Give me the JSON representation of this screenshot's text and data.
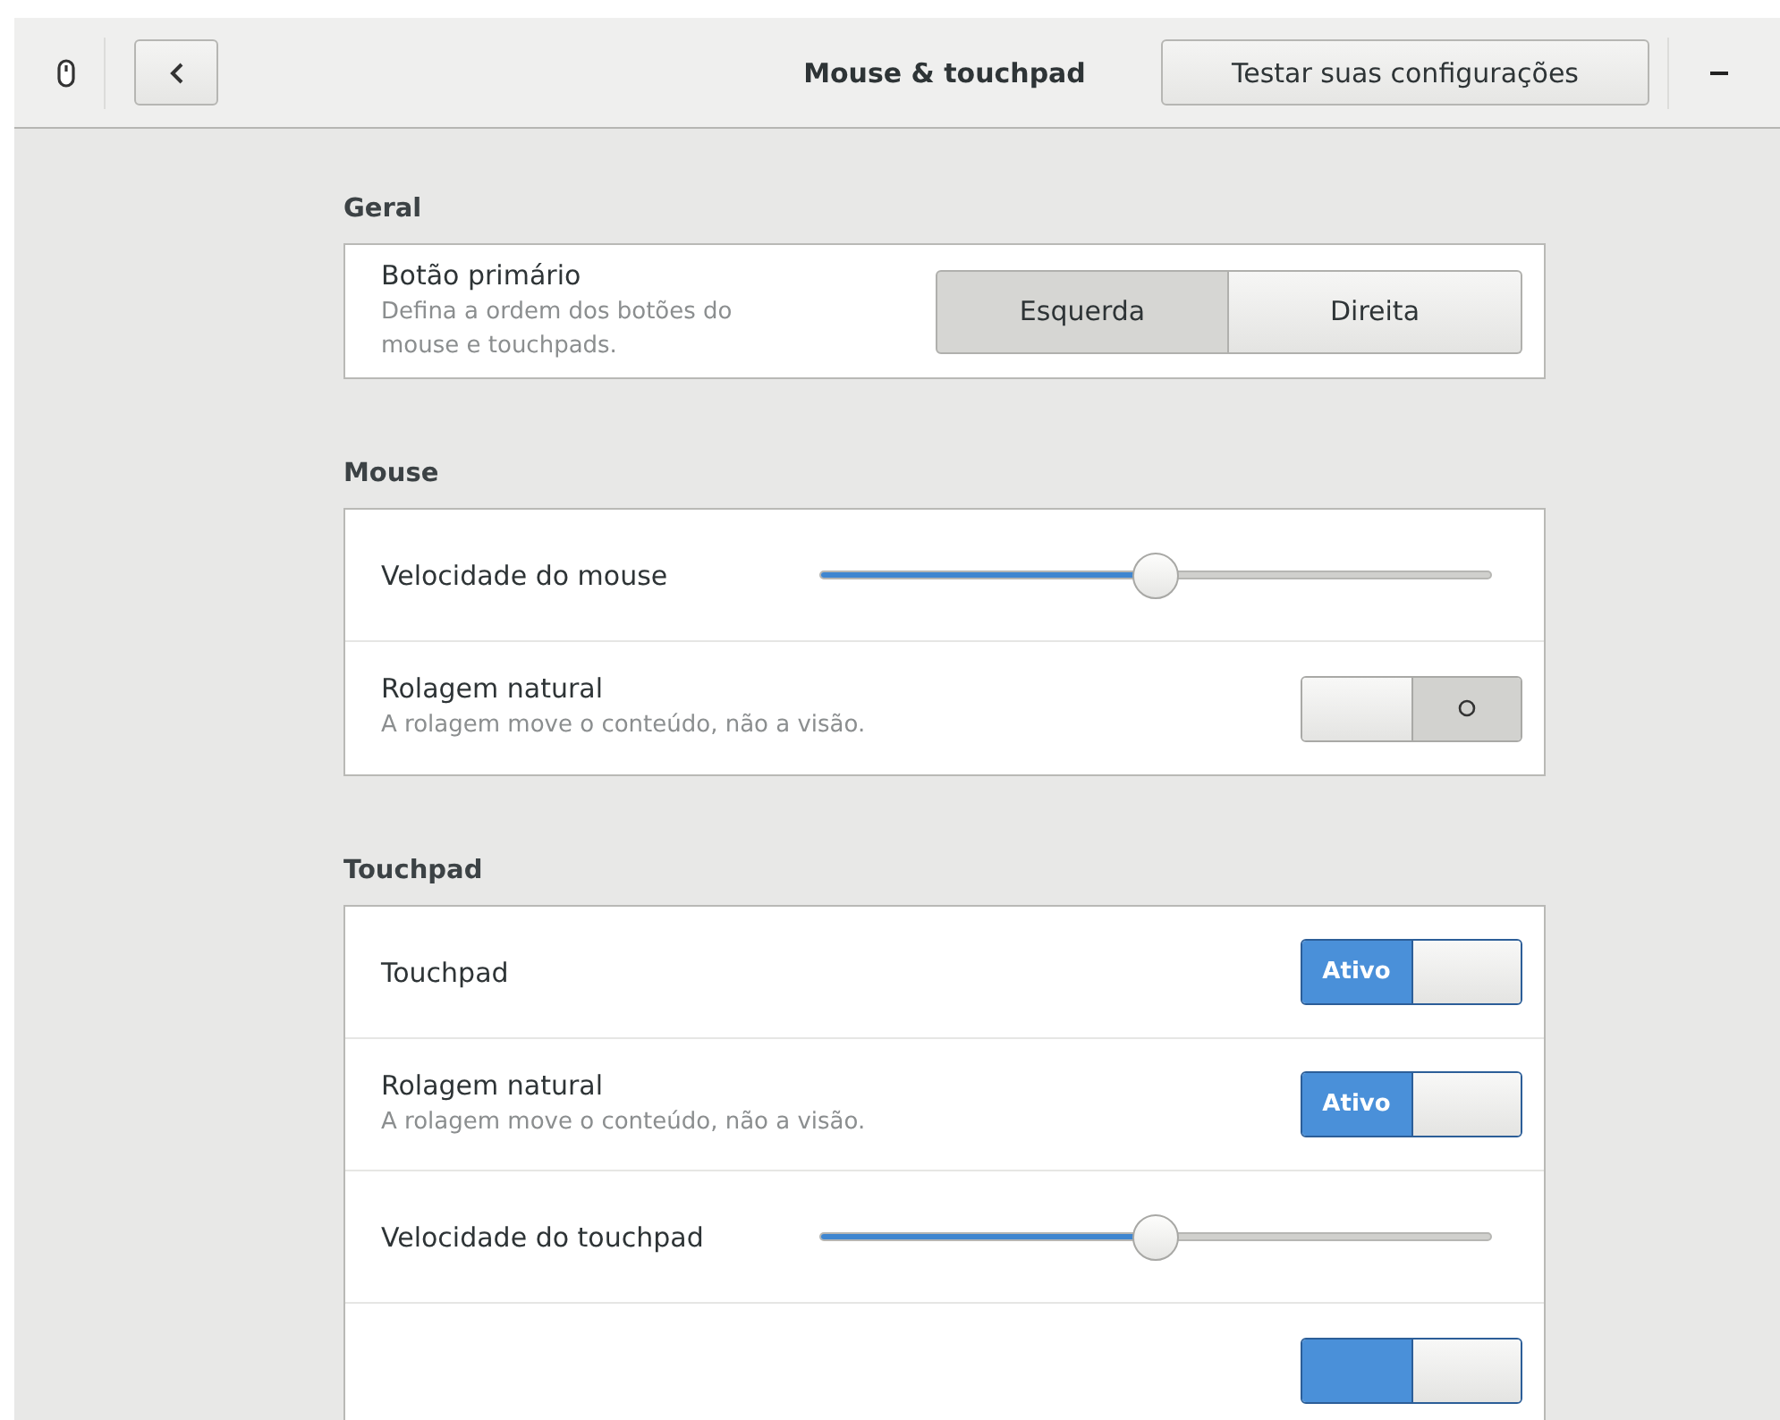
{
  "header": {
    "title": "Mouse & touchpad",
    "test_button": "Testar suas configurações"
  },
  "sections": [
    {
      "title": "Geral",
      "rows": [
        {
          "kind": "choice",
          "label": "Botão primário",
          "description": "Defina a ordem dos botões do mouse e touchpads.",
          "options": [
            {
              "label": "Esquerda",
              "selected": true
            },
            {
              "label": "Direita",
              "selected": false
            }
          ]
        }
      ]
    },
    {
      "title": "Mouse",
      "rows": [
        {
          "kind": "slider",
          "label": "Velocidade do mouse",
          "level": 0.5
        },
        {
          "kind": "switch",
          "label": "Rolagem natural",
          "description": "A rolagem move o conteúdo, não a visão.",
          "on": false
        }
      ]
    },
    {
      "title": "Touchpad",
      "rows": [
        {
          "kind": "switch",
          "label": "Touchpad",
          "on": true,
          "on_text": "Ativo"
        },
        {
          "kind": "switch",
          "label": "Rolagem natural",
          "description": "A rolagem move o conteúdo, não a visão.",
          "on": true,
          "on_text": "Ativo"
        },
        {
          "kind": "slider",
          "label": "Velocidade do touchpad",
          "level": 0.5
        },
        {
          "kind": "switch",
          "on": true
        }
      ]
    }
  ]
}
